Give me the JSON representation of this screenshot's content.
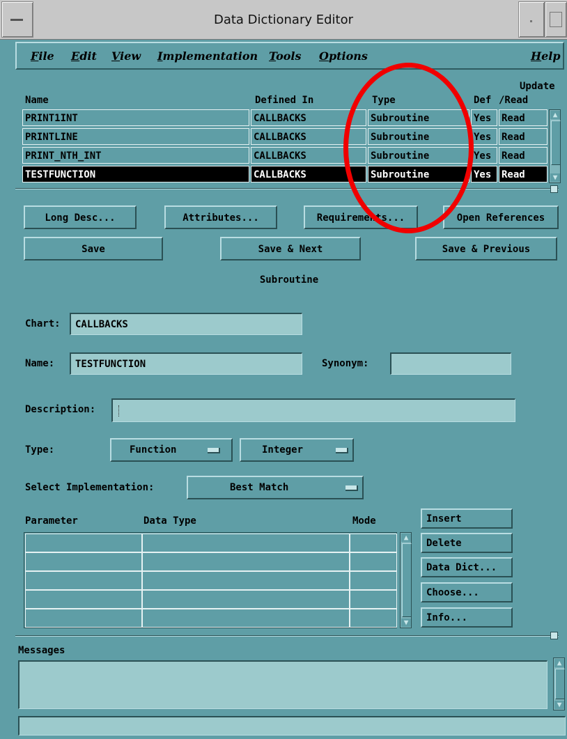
{
  "window": {
    "title": "Data Dictionary Editor"
  },
  "menu": [
    {
      "key": "F",
      "rest": "ile"
    },
    {
      "key": "E",
      "rest": "dit"
    },
    {
      "key": "V",
      "rest": "iew"
    },
    {
      "key": "I",
      "rest": "mplementation"
    },
    {
      "key": "T",
      "rest": "ools"
    },
    {
      "key": "O",
      "rest": "ptions"
    }
  ],
  "help_menu": {
    "key": "H",
    "rest": "elp"
  },
  "table": {
    "headers": {
      "name": "Name",
      "defined_in": "Defined In",
      "type": "Type",
      "def": "Def",
      "update_line1": "Update",
      "update_line2": "/Read"
    },
    "rows": [
      {
        "name": "PRINT1INT",
        "defined_in": "CALLBACKS",
        "type": "Subroutine",
        "def": "Yes",
        "update": "Read",
        "selected": false
      },
      {
        "name": "PRINTLINE",
        "defined_in": "CALLBACKS",
        "type": "Subroutine",
        "def": "Yes",
        "update": "Read",
        "selected": false
      },
      {
        "name": "PRINT_NTH_INT",
        "defined_in": "CALLBACKS",
        "type": "Subroutine",
        "def": "Yes",
        "update": "Read",
        "selected": false
      },
      {
        "name": "TESTFUNCTION",
        "defined_in": "CALLBACKS",
        "type": "Subroutine",
        "def": "Yes",
        "update": "Read",
        "selected": true
      }
    ]
  },
  "buttons": {
    "long_desc": "Long Desc...",
    "attributes": "Attributes...",
    "requirements": "Requirements...",
    "open_references": "Open References",
    "save": "Save",
    "save_next": "Save & Next",
    "save_previous": "Save & Previous"
  },
  "section_title": "Subroutine",
  "form": {
    "chart_label": "Chart:",
    "chart_value": "CALLBACKS",
    "name_label": "Name:",
    "name_value": "TESTFUNCTION",
    "synonym_label": "Synonym:",
    "synonym_value": "",
    "description_label": "Description:",
    "description_value": "",
    "type_label": "Type:",
    "type_value1": "Function",
    "type_value2": "Integer",
    "impl_label": "Select Implementation:",
    "impl_value": "Best Match"
  },
  "params": {
    "headers": {
      "parameter": "Parameter",
      "data_type": "Data Type",
      "mode": "Mode"
    },
    "buttons": {
      "insert": "Insert",
      "delete": "Delete",
      "data_dict": "Data Dict...",
      "choose": "Choose...",
      "info": "Info..."
    }
  },
  "messages": {
    "label": "Messages"
  },
  "colors": {
    "background": "#5f9ea6",
    "field": "#9ccacc",
    "selection": "#000000",
    "annotation": "#f00000"
  }
}
